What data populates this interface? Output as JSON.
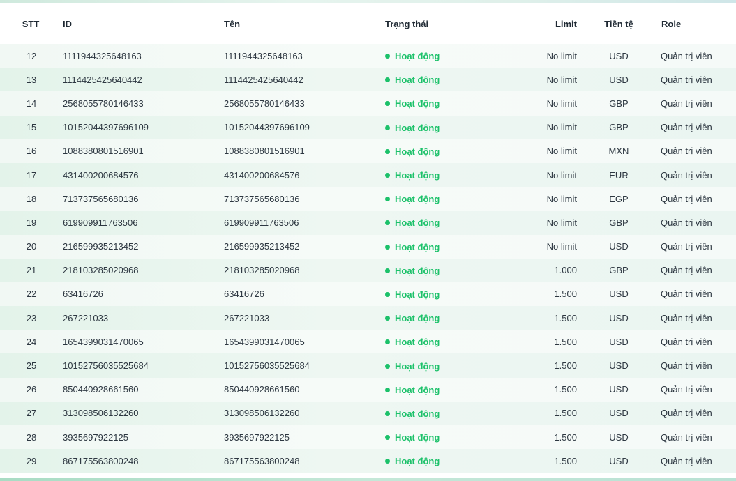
{
  "colors": {
    "status_active": "#1cc16a",
    "row_odd": "#f1f8f4",
    "row_even": "#e3f3ea",
    "header_text": "#1f2933"
  },
  "table": {
    "headers": {
      "stt": "STT",
      "id": "ID",
      "name": "Tên",
      "status": "Trạng thái",
      "limit": "Limit",
      "currency": "Tiền tệ",
      "role": "Role"
    },
    "rows": [
      {
        "stt": "12",
        "id": "1111944325648163",
        "name": "1111944325648163",
        "status": "Hoạt động",
        "limit": "No limit",
        "currency": "USD",
        "role": "Quản trị viên"
      },
      {
        "stt": "13",
        "id": "1114425425640442",
        "name": "1114425425640442",
        "status": "Hoạt động",
        "limit": "No limit",
        "currency": "USD",
        "role": "Quản trị viên"
      },
      {
        "stt": "14",
        "id": "2568055780146433",
        "name": "2568055780146433",
        "status": "Hoạt động",
        "limit": "No limit",
        "currency": "GBP",
        "role": "Quản trị viên"
      },
      {
        "stt": "15",
        "id": "10152044397696109",
        "name": "10152044397696109",
        "status": "Hoạt động",
        "limit": "No limit",
        "currency": "GBP",
        "role": "Quản trị viên"
      },
      {
        "stt": "16",
        "id": "1088380801516901",
        "name": "1088380801516901",
        "status": "Hoạt động",
        "limit": "No limit",
        "currency": "MXN",
        "role": "Quản trị viên"
      },
      {
        "stt": "17",
        "id": "431400200684576",
        "name": "431400200684576",
        "status": "Hoạt động",
        "limit": "No limit",
        "currency": "EUR",
        "role": "Quản trị viên"
      },
      {
        "stt": "18",
        "id": "713737565680136",
        "name": "713737565680136",
        "status": "Hoạt động",
        "limit": "No limit",
        "currency": "EGP",
        "role": "Quản trị viên"
      },
      {
        "stt": "19",
        "id": "619909911763506",
        "name": "619909911763506",
        "status": "Hoạt động",
        "limit": "No limit",
        "currency": "GBP",
        "role": "Quản trị viên"
      },
      {
        "stt": "20",
        "id": "216599935213452",
        "name": "216599935213452",
        "status": "Hoạt động",
        "limit": "No limit",
        "currency": "USD",
        "role": "Quản trị viên"
      },
      {
        "stt": "21",
        "id": "218103285020968",
        "name": "218103285020968",
        "status": "Hoạt động",
        "limit": "1.000",
        "currency": "GBP",
        "role": "Quản trị viên"
      },
      {
        "stt": "22",
        "id": "63416726",
        "name": "63416726",
        "status": "Hoạt động",
        "limit": "1.500",
        "currency": "USD",
        "role": "Quản trị viên"
      },
      {
        "stt": "23",
        "id": "267221033",
        "name": "267221033",
        "status": "Hoạt động",
        "limit": "1.500",
        "currency": "USD",
        "role": "Quản trị viên"
      },
      {
        "stt": "24",
        "id": "1654399031470065",
        "name": "1654399031470065",
        "status": "Hoạt động",
        "limit": "1.500",
        "currency": "USD",
        "role": "Quản trị viên"
      },
      {
        "stt": "25",
        "id": "10152756035525684",
        "name": "10152756035525684",
        "status": "Hoạt động",
        "limit": "1.500",
        "currency": "USD",
        "role": "Quản trị viên"
      },
      {
        "stt": "26",
        "id": "850440928661560",
        "name": "850440928661560",
        "status": "Hoạt động",
        "limit": "1.500",
        "currency": "USD",
        "role": "Quản trị viên"
      },
      {
        "stt": "27",
        "id": "313098506132260",
        "name": "313098506132260",
        "status": "Hoạt động",
        "limit": "1.500",
        "currency": "USD",
        "role": "Quản trị viên"
      },
      {
        "stt": "28",
        "id": "3935697922125",
        "name": "3935697922125",
        "status": "Hoạt động",
        "limit": "1.500",
        "currency": "USD",
        "role": "Quản trị viên"
      },
      {
        "stt": "29",
        "id": "867175563800248",
        "name": "867175563800248",
        "status": "Hoạt động",
        "limit": "1.500",
        "currency": "USD",
        "role": "Quản trị viên"
      }
    ]
  }
}
